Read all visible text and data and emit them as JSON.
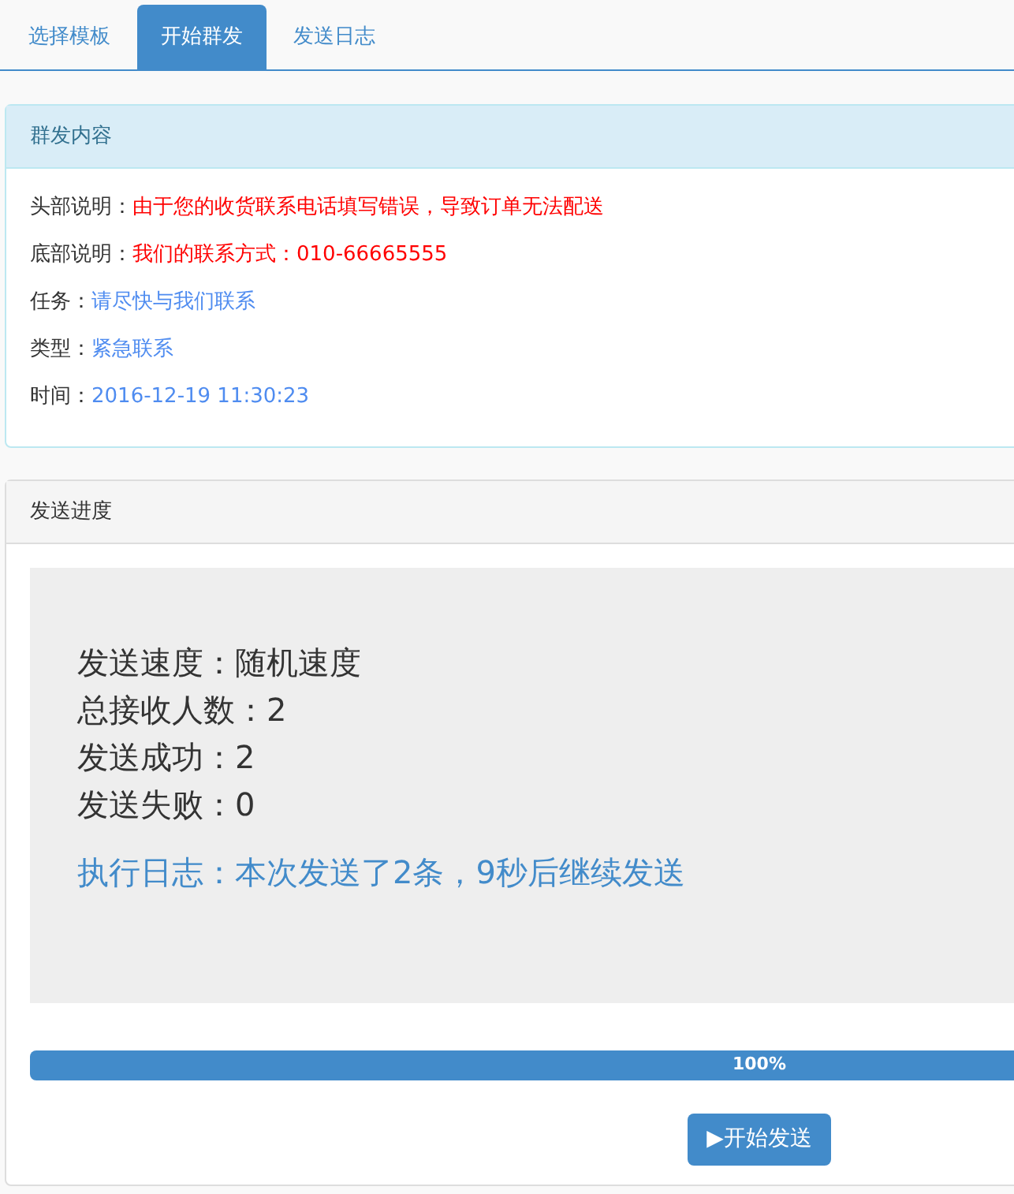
{
  "tabs": [
    {
      "label": "选择模板",
      "selected": false
    },
    {
      "label": "开始群发",
      "selected": true
    },
    {
      "label": "发送日志",
      "selected": false
    }
  ],
  "content_panel": {
    "title": "群发内容",
    "fields": [
      {
        "label": "头部说明：",
        "value": "由于您的收货联系电话填写错误，导致订单无法配送",
        "color": "#ff0000"
      },
      {
        "label": "底部说明：",
        "value": "我们的联系方式：010-66665555",
        "color": "#ff0000"
      },
      {
        "label": "任务：",
        "value": "请尽快与我们联系",
        "color": "#4f8cf0"
      },
      {
        "label": "类型：",
        "value": "紧急联系",
        "color": "#4f8cf0"
      },
      {
        "label": "时间：",
        "value": "2016-12-19 11:30:23",
        "color": "#4f8cf0"
      }
    ]
  },
  "progress_panel": {
    "title": "发送进度",
    "stats": [
      "发送速度：随机速度",
      "总接收人数：2",
      "发送成功：2",
      "发送失败：0"
    ],
    "log": "执行日志：本次发送了2条，9秒后继续发送",
    "progress": {
      "level": 1,
      "reading": "100%"
    },
    "button": {
      "icon": "▶",
      "label": "开始发送"
    }
  }
}
